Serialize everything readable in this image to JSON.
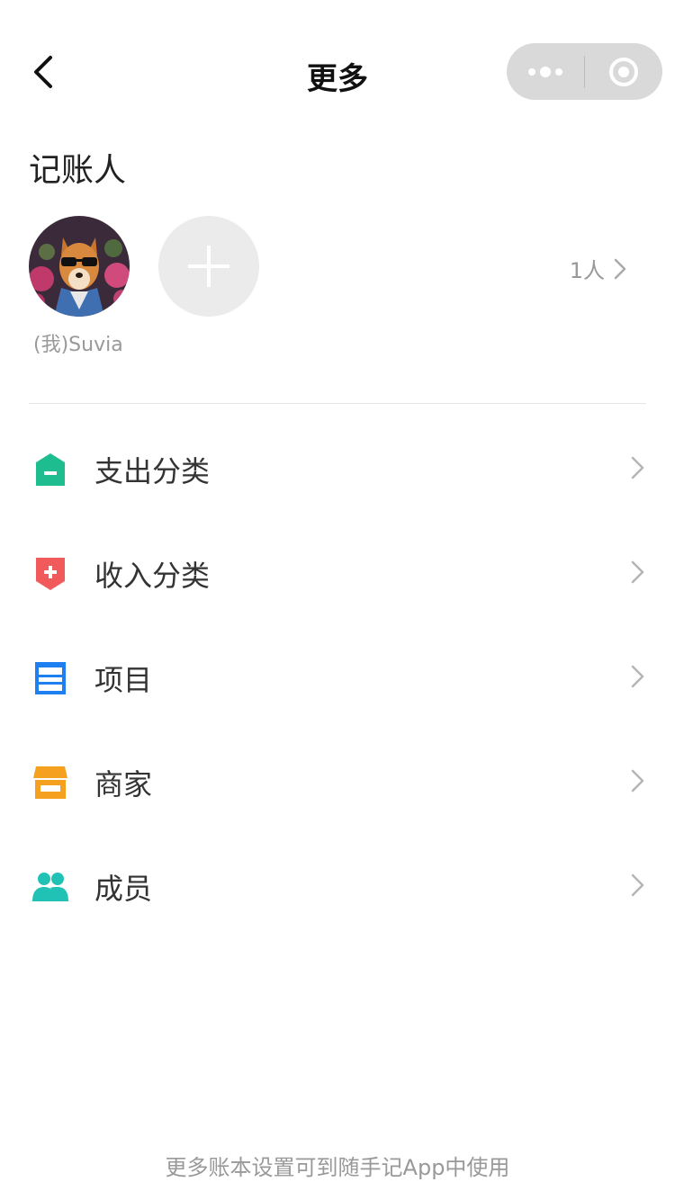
{
  "nav": {
    "title": "更多",
    "back_icon": "chevron-left-icon",
    "capsule_more_icon": "more-dots-icon",
    "capsule_close_icon": "target-icon"
  },
  "bookkeepers": {
    "title": "记账人",
    "members": [
      {
        "name": "(我)Suvia",
        "avatar_icon": "dog-with-sunglasses-avatar"
      }
    ],
    "add_icon": "plus-icon",
    "count_label": "1人"
  },
  "menu": {
    "items": [
      {
        "label": "支出分类",
        "icon": "expense-category-icon",
        "color": "#1ebd8f"
      },
      {
        "label": "收入分类",
        "icon": "income-category-icon",
        "color": "#f15a5a"
      },
      {
        "label": "项目",
        "icon": "project-icon",
        "color": "#1e7ff0"
      },
      {
        "label": "商家",
        "icon": "store-icon",
        "color": "#f5a11f"
      },
      {
        "label": "成员",
        "icon": "members-icon",
        "color": "#1fc2b5"
      }
    ]
  },
  "footer": {
    "text": "更多账本设置可到随手记App中使用"
  },
  "colors": {
    "capsule_bg": "#d9d9d9",
    "add_button_bg": "#ebebeb",
    "secondary_text": "#999999",
    "divider": "#e5e5e5"
  }
}
